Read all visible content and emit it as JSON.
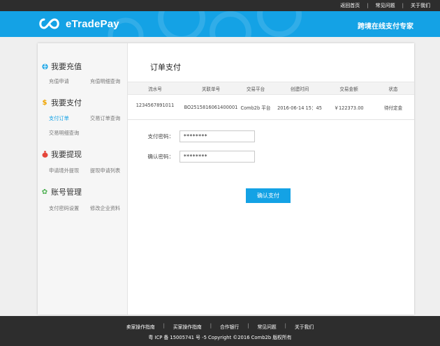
{
  "topbar": {
    "links": [
      "返回首页",
      "常见问题",
      "关于我们"
    ]
  },
  "header": {
    "brand": "eTradePay",
    "slogan": "跨境在线支付专家"
  },
  "sidebar": {
    "groups": [
      {
        "title": "我要充值",
        "icon": "globe-icon",
        "items": [
          "充值申请",
          "充值明细查询"
        ]
      },
      {
        "title": "我要支付",
        "icon": "dollar-icon",
        "items": [
          "支付订单",
          "交易订单查询",
          "交易明细查询"
        ]
      },
      {
        "title": "我要提现",
        "icon": "moneybag-icon",
        "items": [
          "申请境外提现",
          "提现申请列表"
        ]
      },
      {
        "title": "账号管理",
        "icon": "gear-icon",
        "items": [
          "支付密码设置",
          "修改企业资料"
        ]
      }
    ],
    "active_item": "支付订单"
  },
  "main": {
    "title": "订单支付",
    "table": {
      "headers": [
        "流水号",
        "关联单号",
        "交易平台",
        "创建时间",
        "交易金额",
        "状态"
      ],
      "rows": [
        [
          "1234567891011",
          "BO2515816061400001",
          "Comb2b 平台",
          "2016-06-14 15：45",
          "￥122373.00",
          "待付定金"
        ]
      ]
    },
    "form": {
      "pay_password_label": "支付密码：",
      "pay_password_value": "********",
      "confirm_password_label": "确认密码：",
      "confirm_password_value": "********"
    },
    "submit_label": "确认支付"
  },
  "footer": {
    "links": [
      "卖家操作指南",
      "买家操作指南",
      "合作银行",
      "常见问题",
      "关于我们"
    ],
    "copyright": "粤 ICP 备 15005741 号 -5 Copyright ©2016 Comb2b 版权所有"
  },
  "colors": {
    "accent": "#14a2e5",
    "dark": "#2d2d2d",
    "active_link": "#14a2e5"
  }
}
